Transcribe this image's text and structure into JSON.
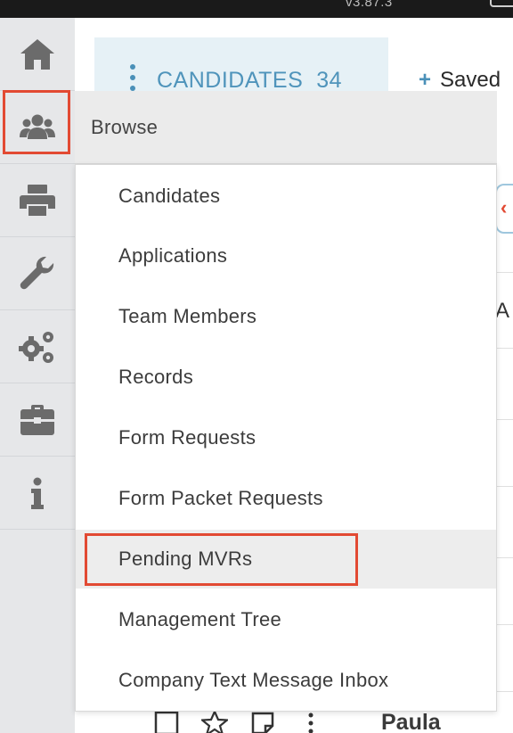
{
  "status_bar": {
    "version": "v3.87.3"
  },
  "rail": {
    "items": [
      {
        "icon": "home-icon"
      },
      {
        "icon": "users-icon",
        "active": true
      },
      {
        "icon": "printer-icon"
      },
      {
        "icon": "wrench-icon"
      },
      {
        "icon": "gears-icon"
      },
      {
        "icon": "briefcase-icon"
      },
      {
        "icon": "info-icon"
      }
    ]
  },
  "header": {
    "candidates_label": "CANDIDATES",
    "candidates_count": "34",
    "saved_label": "Saved"
  },
  "background": {
    "peek_text": "A",
    "paula": "Paula"
  },
  "flyout": {
    "title": "Browse",
    "items": [
      {
        "label": "Candidates"
      },
      {
        "label": "Applications"
      },
      {
        "label": "Team Members"
      },
      {
        "label": "Records"
      },
      {
        "label": "Form Requests"
      },
      {
        "label": "Form Packet Requests"
      },
      {
        "label": "Pending MVRs",
        "highlighted": true
      },
      {
        "label": "Management Tree"
      },
      {
        "label": "Company Text Message Inbox"
      }
    ]
  },
  "colors": {
    "accent_blue": "#4f94bb",
    "highlight_red": "#e24a33",
    "icon_gray": "#6b6b6b"
  }
}
